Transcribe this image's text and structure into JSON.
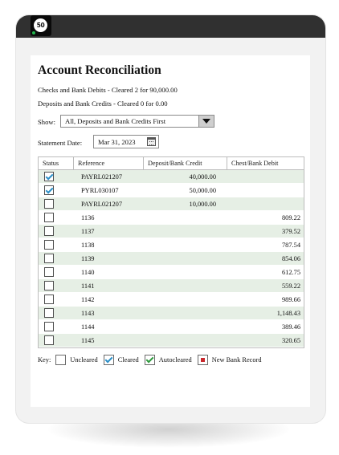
{
  "app": {
    "logo_text": "50"
  },
  "page": {
    "title": "Account Reconciliation",
    "checks_summary": "Checks and Bank Debits - Cleared 2 for 90,000.00",
    "deposits_summary": "Deposits and Bank Credits - Cleared 0 for 0.00"
  },
  "filter": {
    "show_label": "Show:",
    "show_value": "All, Deposits and Bank Credits First",
    "date_label": "Statement Date:",
    "date_value": "Mar 31, 2023"
  },
  "table": {
    "headers": [
      "Status",
      "Reference",
      "Deposit/Bank Credit",
      "Chest/Bank Debit"
    ],
    "rows": [
      {
        "checked": true,
        "reference": "PAYRL021207",
        "credit": "40,000.00",
        "debit": ""
      },
      {
        "checked": true,
        "reference": "PYRL030107",
        "credit": "50,000.00",
        "debit": ""
      },
      {
        "checked": false,
        "reference": "PAYRL021207",
        "credit": "10,000.00",
        "debit": ""
      },
      {
        "checked": false,
        "reference": "1136",
        "credit": "",
        "debit": "809.22"
      },
      {
        "checked": false,
        "reference": "1137",
        "credit": "",
        "debit": "379.52"
      },
      {
        "checked": false,
        "reference": "1138",
        "credit": "",
        "debit": "787.54"
      },
      {
        "checked": false,
        "reference": "1139",
        "credit": "",
        "debit": "854.06"
      },
      {
        "checked": false,
        "reference": "1140",
        "credit": "",
        "debit": "612.75"
      },
      {
        "checked": false,
        "reference": "1141",
        "credit": "",
        "debit": "559.22"
      },
      {
        "checked": false,
        "reference": "1142",
        "credit": "",
        "debit": "989.66"
      },
      {
        "checked": false,
        "reference": "1143",
        "credit": "",
        "debit": "1,148.43"
      },
      {
        "checked": false,
        "reference": "1144",
        "credit": "",
        "debit": "389.46"
      },
      {
        "checked": false,
        "reference": "1145",
        "credit": "",
        "debit": "320.65"
      }
    ]
  },
  "key": {
    "label": "Key:",
    "uncleared": "Uncleared",
    "cleared": "Cleared",
    "autocleared": "Autocleared",
    "new_bank_record": "New Bank Record"
  },
  "colors": {
    "row_stripe": "#e6efe5",
    "check_blue": "#2b8fc7",
    "check_green": "#2f9a3e",
    "bank_red": "#c9282d",
    "device_bar": "#303030"
  }
}
